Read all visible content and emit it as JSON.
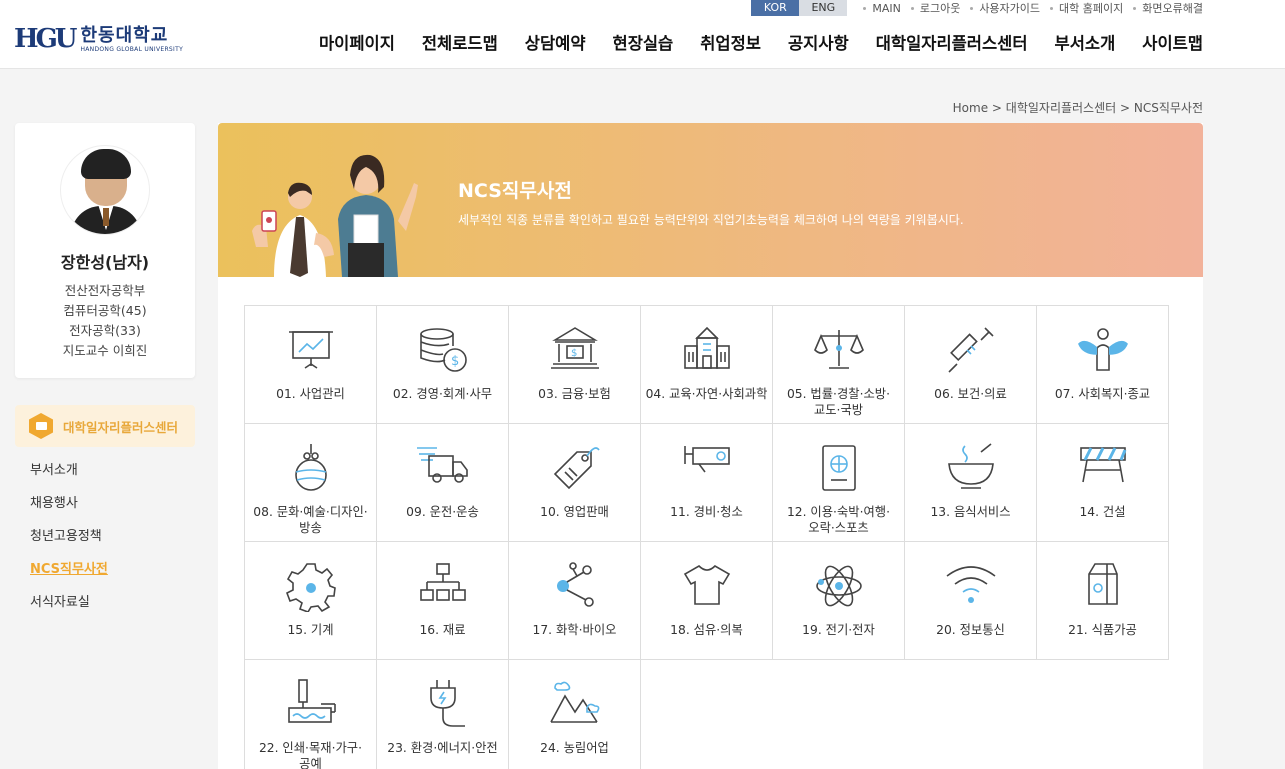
{
  "util": {
    "lang_kor": "KOR",
    "lang_eng": "ENG",
    "links": [
      "MAIN",
      "로그아웃",
      "사용자가이드",
      "대학 홈페이지",
      "화면오류해결"
    ]
  },
  "logo": {
    "mark": "HGU",
    "name_ko": "한동대학교",
    "name_en": "HANDONG GLOBAL UNIVERSITY"
  },
  "gnb": [
    "마이페이지",
    "전체로드맵",
    "상담예약",
    "현장실습",
    "취업정보",
    "공지사항",
    "대학일자리플러스센터",
    "부서소개",
    "사이트맵"
  ],
  "breadcrumb": "Home > 대학일자리플러스센터 > NCS직무사전",
  "profile": {
    "name": "장한성(남자)",
    "info": [
      "전산전자공학부",
      "컴퓨터공학(45)",
      "전자공학(33)",
      "지도교수 이희진"
    ]
  },
  "side": {
    "title": "대학일자리플러스센터",
    "items": [
      "부서소개",
      "채용행사",
      "청년고용정책",
      "NCS직무사전",
      "서식자료실"
    ]
  },
  "banner": {
    "title": "NCS직무사전",
    "subtitle": "세부적인 직종 분류를 확인하고 필요한 능력단위와 직업기초능력을 체크하여 나의 역량을 키워봅시다."
  },
  "colors": {
    "accent": "#f0a830",
    "brand": "#1d3b78",
    "icon_blue": "#5bb5e8"
  },
  "categories": [
    {
      "label": "01. 사업관리",
      "icon": "presentation-board-icon"
    },
    {
      "label": "02. 경영·회계·사무",
      "icon": "coins-dollar-icon"
    },
    {
      "label": "03. 금융·보험",
      "icon": "bank-icon"
    },
    {
      "label": "04. 교육·자연·사회과학",
      "icon": "school-building-icon"
    },
    {
      "label": "05. 법률·경찰·소방·\n교도·국방",
      "icon": "scales-icon"
    },
    {
      "label": "06. 보건·의료",
      "icon": "syringe-icon"
    },
    {
      "label": "07. 사회복지·종교",
      "icon": "angel-icon"
    },
    {
      "label": "08. 문화·예술·디자인·\n방송",
      "icon": "ornament-ball-icon"
    },
    {
      "label": "09. 운전·운송",
      "icon": "truck-icon"
    },
    {
      "label": "10. 영업판매",
      "icon": "price-tag-icon"
    },
    {
      "label": "11. 경비·청소",
      "icon": "cctv-camera-icon"
    },
    {
      "label": "12. 이용·숙박·여행·\n오락·스포츠",
      "icon": "passport-icon"
    },
    {
      "label": "13. 음식서비스",
      "icon": "food-bowl-icon"
    },
    {
      "label": "14. 건설",
      "icon": "barricade-icon"
    },
    {
      "label": "15. 기계",
      "icon": "gear-icon"
    },
    {
      "label": "16. 재료",
      "icon": "hierarchy-icon"
    },
    {
      "label": "17. 화학·바이오",
      "icon": "molecule-icon"
    },
    {
      "label": "18. 섬유·의복",
      "icon": "tshirt-icon"
    },
    {
      "label": "19. 전기·전자",
      "icon": "atom-icon"
    },
    {
      "label": "20. 정보통신",
      "icon": "wifi-icon"
    },
    {
      "label": "21. 식품가공",
      "icon": "milk-carton-icon"
    },
    {
      "label": "22. 인쇄·목재·가구·\n공예",
      "icon": "paint-roller-icon"
    },
    {
      "label": "23. 환경·에너지·안전",
      "icon": "power-plug-icon"
    },
    {
      "label": "24. 농림어업",
      "icon": "mountains-icon"
    }
  ]
}
